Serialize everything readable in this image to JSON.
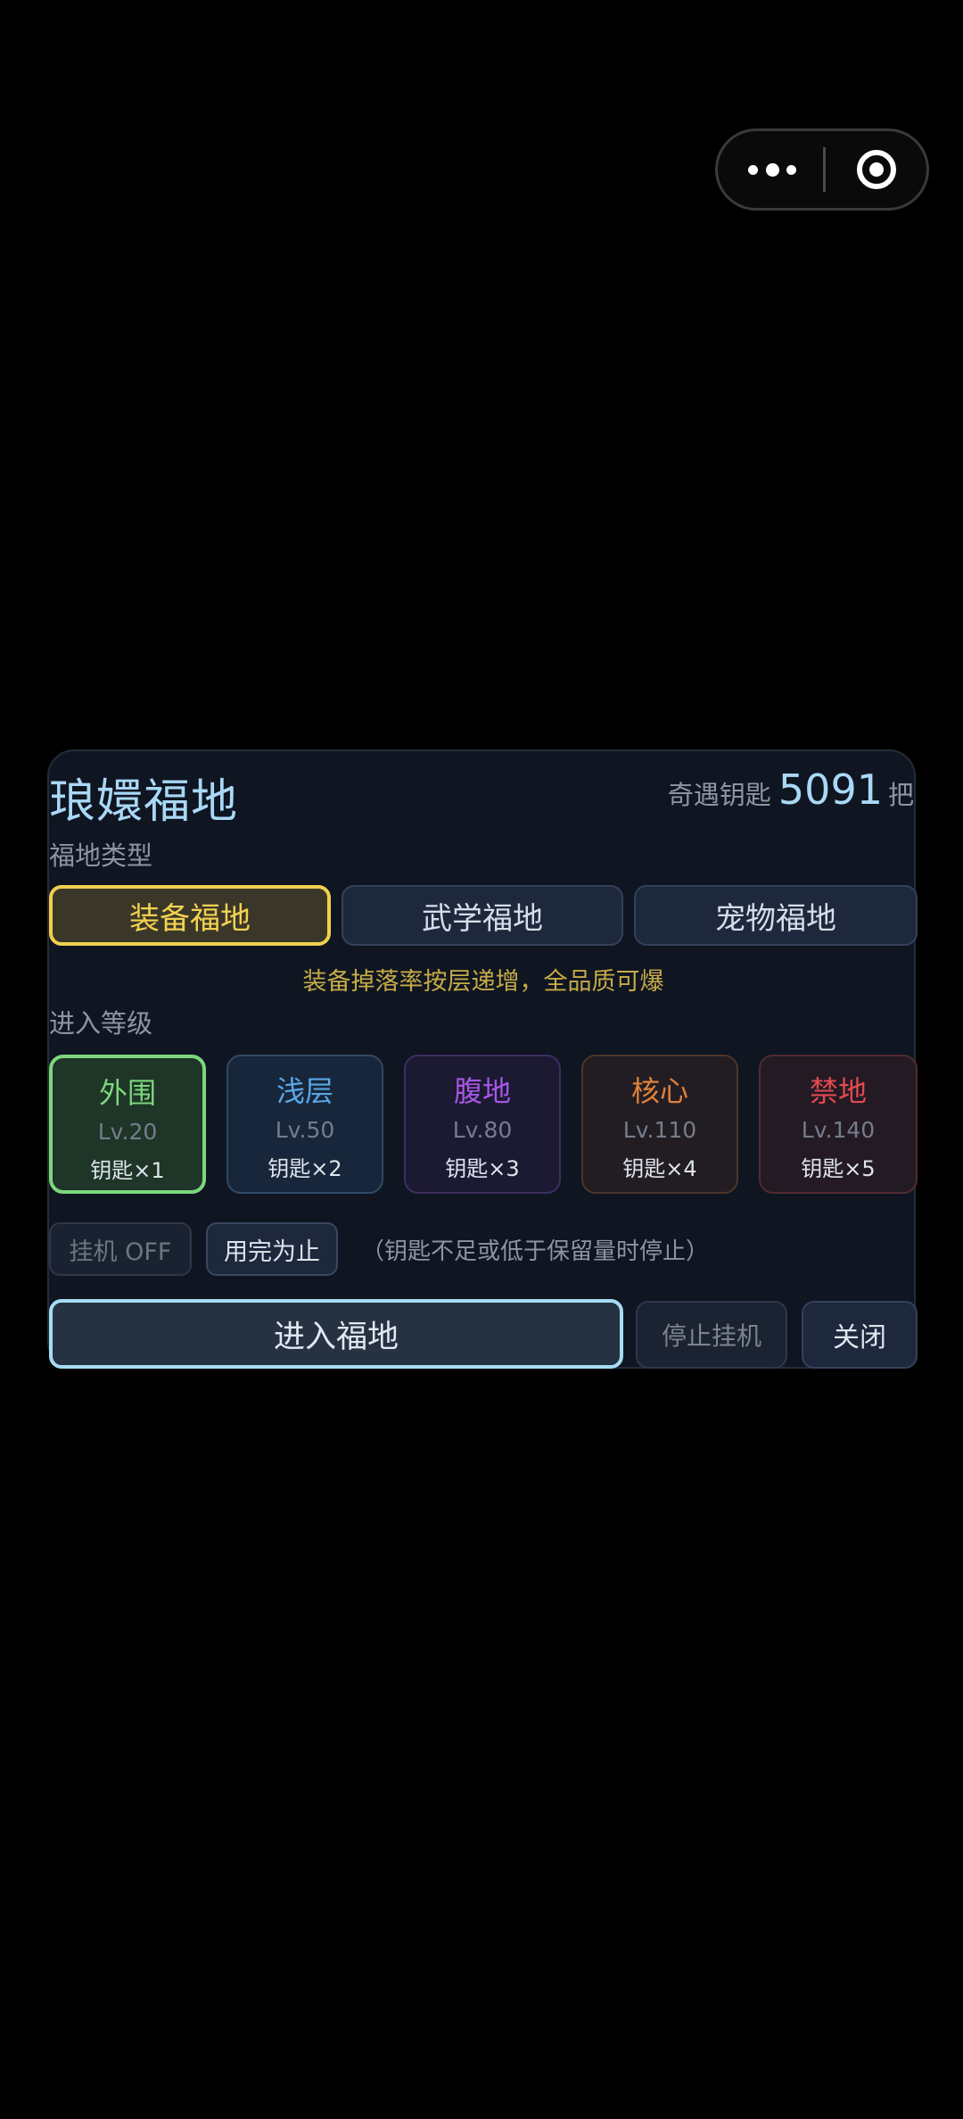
{
  "capsule": {
    "more_icon": "more-dots-icon",
    "target_icon": "target-icon"
  },
  "panel": {
    "title": "琅嬛福地",
    "keys": {
      "label": "奇遇钥匙",
      "count": "5091",
      "unit": "把"
    },
    "type_section_label": "福地类型",
    "types": [
      {
        "label": "装备福地",
        "active": true
      },
      {
        "label": "武学福地",
        "active": false
      },
      {
        "label": "宠物福地",
        "active": false
      }
    ],
    "type_hint": "装备掉落率按层递增，全品质可爆",
    "level_section_label": "进入等级",
    "levels": [
      {
        "name": "外围",
        "lv": "Lv.20",
        "cost": "钥匙×1",
        "color": "#7dd67e",
        "selected": true
      },
      {
        "name": "浅层",
        "lv": "Lv.50",
        "cost": "钥匙×2",
        "color": "#5aa7e6",
        "selected": false
      },
      {
        "name": "腹地",
        "lv": "Lv.80",
        "cost": "钥匙×3",
        "color": "#a657e4",
        "selected": false
      },
      {
        "name": "核心",
        "lv": "Lv.110",
        "cost": "钥匙×4",
        "color": "#e0823a",
        "selected": false
      },
      {
        "name": "禁地",
        "lv": "Lv.140",
        "cost": "钥匙×5",
        "color": "#e24a4f",
        "selected": false
      }
    ],
    "auto_toggle_label": "挂机 OFF",
    "until_empty_label": "用完为止",
    "stop_note": "（钥匙不足或低于保留量时停止）",
    "enter_label": "进入福地",
    "stop_auto_label": "停止挂机",
    "close_label": "关闭"
  }
}
